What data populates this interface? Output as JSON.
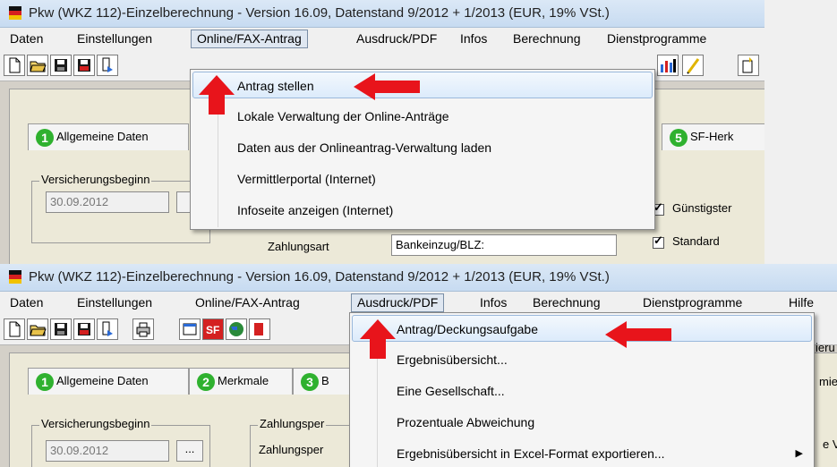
{
  "colors": {
    "arrow": "#e8141b",
    "tab_badge": "#2fb12f",
    "menu_highlight": "#dcebfb"
  },
  "screenshot1": {
    "title": "Pkw (WKZ 112)-Einzelberechnung - Version 16.09, Datenstand 9/2012 + 1/2013 (EUR, 19% VSt.)",
    "menu": [
      "Daten",
      "Einstellungen",
      "Online/FAX-Antrag",
      "Ausdruck/PDF",
      "Infos",
      "Berechnung",
      "Dienstprogramme"
    ],
    "open_menu": "Online/FAX-Antrag",
    "dropdown": [
      "Antrag stellen",
      "Lokale Verwaltung der Online-Anträge",
      "Daten aus der Onlineantrag-Verwaltung laden",
      "Vermittlerportal (Internet)",
      "Infoseite anzeigen (Internet)"
    ],
    "highlighted_item": "Antrag stellen",
    "tabs": [
      {
        "num": "1",
        "label": "Allgemeine Daten"
      },
      {
        "num": "5",
        "label": "SF-Herk"
      }
    ],
    "group_label": "Versicherungsbeginn",
    "date_value": "30.09.2012",
    "zahlungsart_label": "Zahlungsart",
    "zahlungsart_value": "Bankeinzug/BLZ:",
    "checkboxes": [
      {
        "label": "Günstigster",
        "checked": true
      },
      {
        "label": "Standard",
        "checked": true
      }
    ]
  },
  "screenshot2": {
    "title": "Pkw (WKZ 112)-Einzelberechnung - Version 16.09, Datenstand 9/2012 + 1/2013 (EUR, 19% VSt.)",
    "menu": [
      "Daten",
      "Einstellungen",
      "Online/FAX-Antrag",
      "Ausdruck/PDF",
      "Infos",
      "Berechnung",
      "Dienstprogramme",
      "Hilfe"
    ],
    "open_menu": "Ausdruck/PDF",
    "dropdown": [
      "Antrag/Deckungsaufgabe",
      "Ergebnisübersicht...",
      "Eine Gesellschaft...",
      "Prozentuale Abweichung",
      "Ergebnisübersicht in Excel-Format exportieren..."
    ],
    "highlighted_item": "Antrag/Deckungsaufgabe",
    "tabs": [
      {
        "num": "1",
        "label": "Allgemeine Daten"
      },
      {
        "num": "2",
        "label": "Merkmale"
      },
      {
        "num": "3",
        "label": "B"
      }
    ],
    "group_label": "Versicherungsbeginn",
    "date_value": "30.09.2012",
    "dots_label": "...",
    "zahlungsper_label": "Zahlungsper",
    "zahlungsper_label2": "Zahlungsper",
    "right_cut_1": "ieru",
    "right_cut_2": "mie",
    "right_cut_3": "e V"
  }
}
